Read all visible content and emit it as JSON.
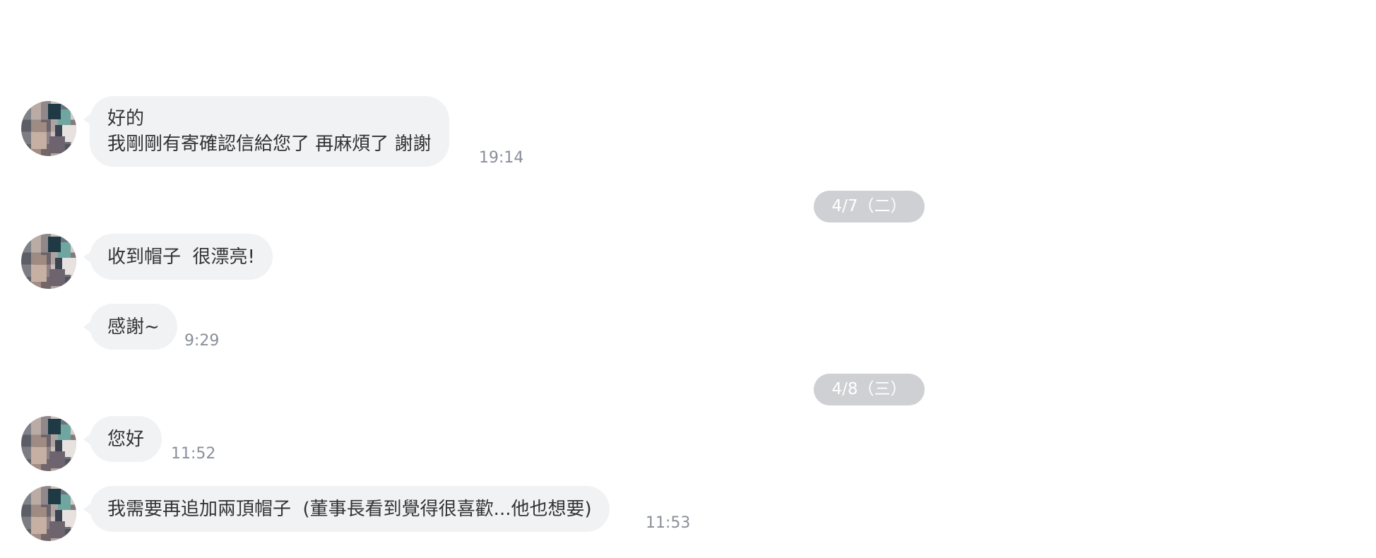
{
  "conversation": {
    "messages": [
      {
        "lines": [
          "好的",
          "我剛剛有寄確認信給您了 再麻煩了 謝謝"
        ],
        "time": "19:14"
      },
      {
        "text": "收到帽子  很漂亮!"
      },
      {
        "text": "感謝~",
        "time": "9:29"
      },
      {
        "text": "您好",
        "time": "11:52"
      },
      {
        "text": "我需要再追加兩頂帽子  (董事長看到覺得很喜歡...他也想要)",
        "time": "11:53"
      }
    ],
    "date_separators": [
      "4/7（二）",
      "4/8（三）"
    ]
  },
  "colors": {
    "bubble_bg": "#f1f2f4",
    "pill_bg": "#cfd0d3",
    "time_text": "#8a8f99"
  }
}
